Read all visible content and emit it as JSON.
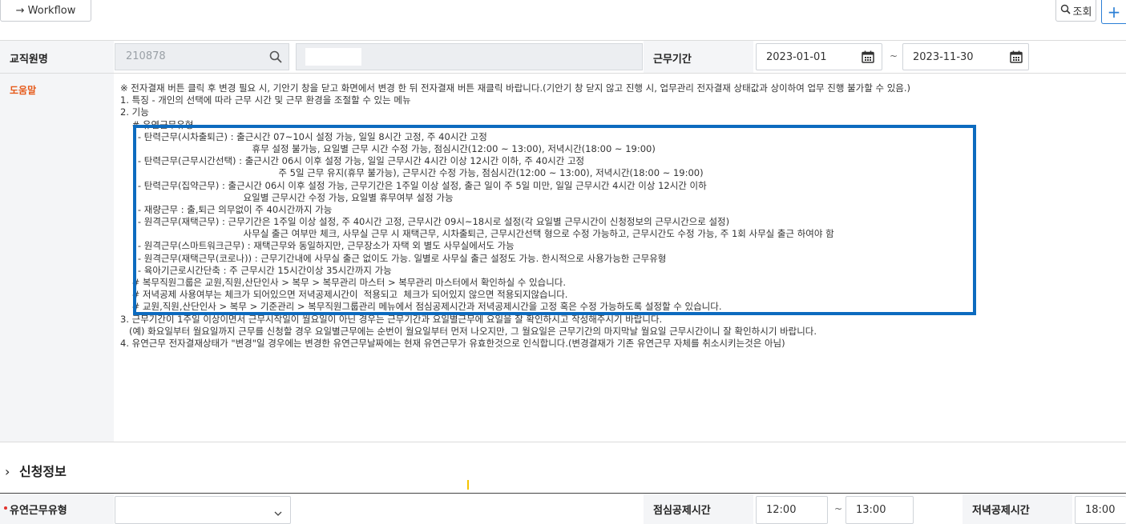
{
  "toolbar": {
    "workflow_label": "→ Workflow",
    "search_label": "조회",
    "add_label": "+"
  },
  "search_form": {
    "staff_label": "교직원명",
    "staff_value": "210878",
    "period_label": "근무기간",
    "date_from": "2023-01-01",
    "date_to": "2023-11-30",
    "range_sep": "~"
  },
  "help": {
    "label": "도움말",
    "lines": [
      "※ 전자결재 버튼 클릭 후 변경 필요 시, 기안기 창을 닫고 화면에서 변경 한 뒤 전자결재 버튼 재클릭 바랍니다.(기안기 창 닫지 않고 진행 시, 업무관리 전자결재 상태값과 상이하여 업무 진행 불가할 수 있음.)",
      "1. 특징 - 개인의 선택에 따라 근무 시간 및 근무 환경을 조절할 수 있는 메뉴",
      "2. 기능",
      "    # 유연근무유형",
      "      - 탄력근무(시차출퇴근) : 출근시간 07~10시 설정 가능, 일일 8시간 고정, 주 40시간 고정",
      "                                             휴무 설정 불가능, 요일별 근무 시간 수정 가능, 점심시간(12:00 ~ 13:00), 저녁시간(18:00 ~ 19:00)",
      "      - 탄력근무(근무시간선택) : 출근시간 06시 이후 설정 가능, 일일 근무시간 4시간 이상 12시간 이하, 주 40시간 고정",
      "                                                      주 5일 근무 유지(휴무 불가능), 근무시간 수정 가능, 점심시간(12:00 ~ 13:00), 저녁시간(18:00 ~ 19:00)",
      "      - 탄력근무(집약근무) : 출근시간 06시 이후 설정 가능, 근무기간은 1주일 이상 설정, 출근 일이 주 5일 미만, 일일 근무시간 4시간 이상 12시간 이하",
      "                                          요일별 근무시간 수정 가능, 요일별 휴무여부 설정 가능",
      "      - 재량근무 : 출,퇴근 의무없이 주 40시간까지 가능",
      "      - 원격근무(재택근무) : 근무기간은 1주일 이상 설정, 주 40시간 고정, 근무시간 09시~18시로 설정(각 요일별 근무시간이 신청정보의 근무시간으로 설정)",
      "                                          사무실 출근 여부만 체크, 사무실 근무 시 재택근무, 시차출퇴근, 근무시간선택 형으로 수정 가능하고, 근무시간도 수정 가능, 주 1회 사무실 출근 하여야 함",
      "      - 원격근무(스마트워크근무) : 재택근무와 동일하지만, 근무장소가 자택 외 별도 사무실에서도 가능",
      "      - 원격근무(재택근무(코로나)) : 근무기간내에 사무실 출근 없이도 가능. 일별로 사무실 출근 설정도 가능. 한시적으로 사용가능한 근무유형",
      "      - 육아기근로시간단축 : 주 근무시간 15시간이상 35시간까지 가능",
      "    # 복무직원그룹은 교원,직원,산단인사 > 복무 > 복무관리 마스터 > 복무관리 마스터에서 확인하실 수 있습니다.",
      "    # 저녁공제 사용여부는 체크가 되어있으면 저녁공제시간이  적용되고  체크가 되어있지 않으면 적용되지않습니다.",
      "    # 교원,직원,산단인사 > 복무 > 기준관리 > 복무직원그룹관리 메뉴에서 점심공제시간과 저녁공제시간을 고정 혹은 수정 가능하도록 설정할 수 있습니다.",
      "3. 근무기간이 1주일 이상이면서 근무시작일이 월요일이 아닌 경우는 근무기간과 요일별근무에 요일을 잘 확인하시고 작성해주시기 바랍니다.",
      "   (예) 화요일부터 월요일까지 근무를 신청할 경우 요일별근무에는 순번이 월요일부터 먼저 나오지만, 그 월요일은 근무기간의 마지막날 월요일 근무시간이니 잘 확인하시기 바랍니다.",
      "4. 유연근무 전자결재상태가 \"변경\"일 경우에는 변경한 유연근무날짜에는 현재 유연근무가 유효한것으로 인식합니다.(변경결재가 기존 유연근무 자체를 취소시키는것은 아님)"
    ]
  },
  "section": {
    "chevron": "›",
    "title": "신청정보"
  },
  "apply_form": {
    "type_label": "유연근무유형",
    "type_value": "",
    "lunch_label": "점심공제시간",
    "lunch_from": "12:00",
    "lunch_to": "13:00",
    "range_sep": "~",
    "dinner_label": "저녁공제시간",
    "dinner_from": "18:00"
  },
  "colors": {
    "highlight_border": "#0d6bbf",
    "help_label": "#e65a1a",
    "required_dot": "#e0322d"
  }
}
